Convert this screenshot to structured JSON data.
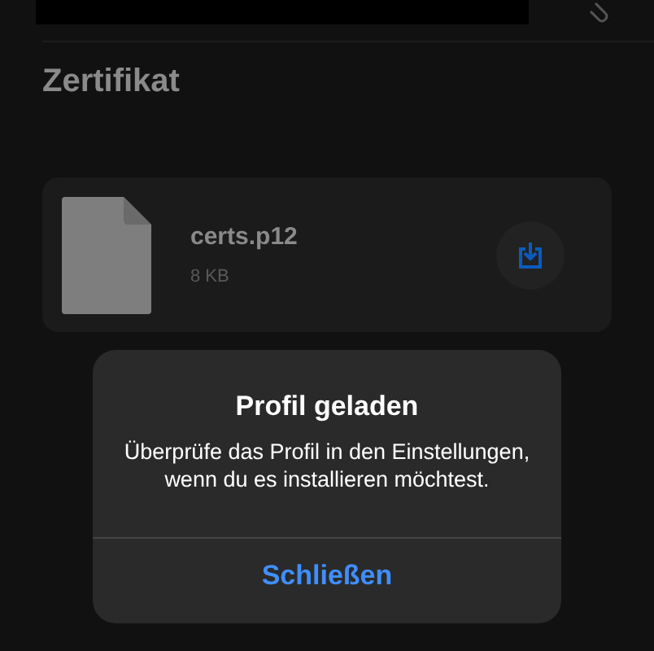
{
  "section_title": "Zertifikat",
  "file": {
    "name": "certs.p12",
    "size": "8 KB"
  },
  "alert": {
    "title": "Profil geladen",
    "message": "Überprüfe das Profil in den Einstellungen, wenn du es installieren möchtest.",
    "button": "Schließen"
  }
}
